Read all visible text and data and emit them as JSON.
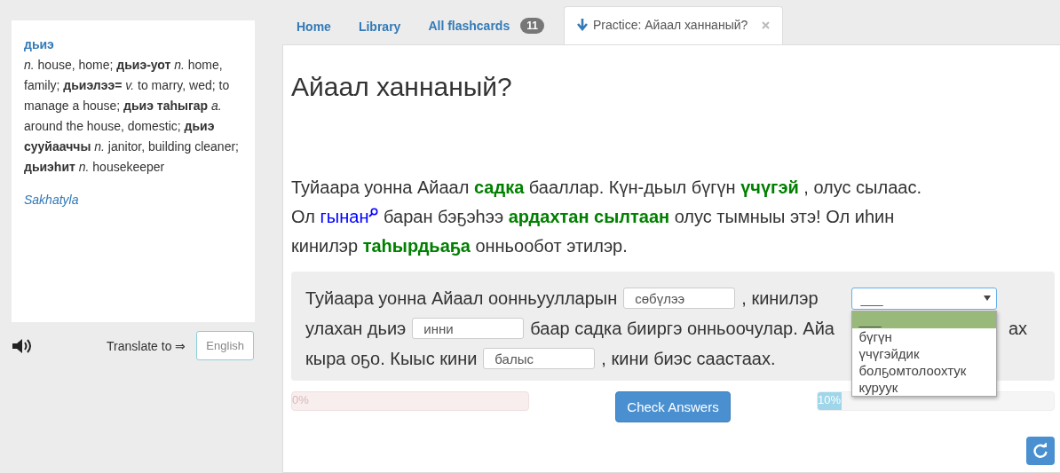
{
  "dictionary": {
    "headword": "дьиэ",
    "definition": "*n.* house, home; **дьиэ-уот** *n.* home, family; **дьиэлээ=** *v.* to marry, wed; to manage a house; **дьиэ таһыгар** *a.* around the house, domestic; **дьиэ сууйааччы** *n.* janitor, building cleaner; **дьиэһит** *n.* housekeeper",
    "source": "Sakhatyla"
  },
  "translate": {
    "label": "Translate to ⇒",
    "language": "English"
  },
  "tabs": [
    {
      "label": "Home",
      "selected": false
    },
    {
      "label": "Library",
      "selected": false
    },
    {
      "label": "All flashcards",
      "badge": "11",
      "selected": false
    },
    {
      "label": "Practice: Айаал ханнаный?",
      "selected": true
    }
  ],
  "title": "Айаал ханнаный?",
  "reading": [
    {
      "kind": "text",
      "text": "Туйаара уонна Айаал"
    },
    {
      "kind": "vocab",
      "text": "садка"
    },
    {
      "kind": "text",
      "text": "бааллар. Күн-дьыл бүгүн"
    },
    {
      "kind": "vocab",
      "text": "үчүгэй"
    },
    {
      "kind": "text",
      "text": ", олус сылаас."
    },
    {
      "kind": "break"
    },
    {
      "kind": "text",
      "text": "Ол"
    },
    {
      "kind": "lookup",
      "text": "гынан"
    },
    {
      "kind": "text",
      "text": "баран бэҕэһээ"
    },
    {
      "kind": "vocab",
      "text": "ардахтан сылтаан"
    },
    {
      "kind": "text",
      "text": "олус тымныы этэ! Ол иһин"
    },
    {
      "kind": "break"
    },
    {
      "kind": "text",
      "text": "кинилэр"
    },
    {
      "kind": "vocab",
      "text": "таһырдьаҕа"
    },
    {
      "kind": "text",
      "text": "онньообот этилэр."
    }
  ],
  "exercise": [
    [
      {
        "kind": "text",
        "text": "Туйаара уонна Айаал оонньуулларын"
      },
      {
        "kind": "input",
        "value": "сөбүлээ"
      },
      {
        "kind": "text",
        "text": ", кинилэр"
      },
      {
        "kind": "select",
        "value": "___",
        "expanded": true,
        "options": [
          {
            "label": "___",
            "selected": true
          },
          {
            "label": "бүгүн",
            "selected": false
          },
          {
            "label": "үчүгэйдик",
            "selected": false
          },
          {
            "label": "болҕомтолоохтук",
            "selected": false
          },
          {
            "label": "куруук",
            "selected": false
          }
        ]
      }
    ],
    [
      {
        "kind": "text",
        "text": "улахан дьиэ"
      },
      {
        "kind": "input",
        "value": "инни"
      },
      {
        "kind": "text",
        "text": "баар садка бииргэ онньоочулар. Айа"
      },
      {
        "kind": "gap"
      },
      {
        "kind": "text",
        "text": "ах"
      }
    ],
    [
      {
        "kind": "text",
        "text": "кыра оҕо. Кыыс кини"
      },
      {
        "kind": "input",
        "value": "балыс"
      },
      {
        "kind": "text",
        "text": ", кини биэс саастаах."
      }
    ]
  ],
  "progress": [
    {
      "reading": "0%",
      "kind": "error"
    },
    {
      "reading": "10%",
      "level": 0.1,
      "kind": "info"
    }
  ],
  "check_button": "Check Answers"
}
